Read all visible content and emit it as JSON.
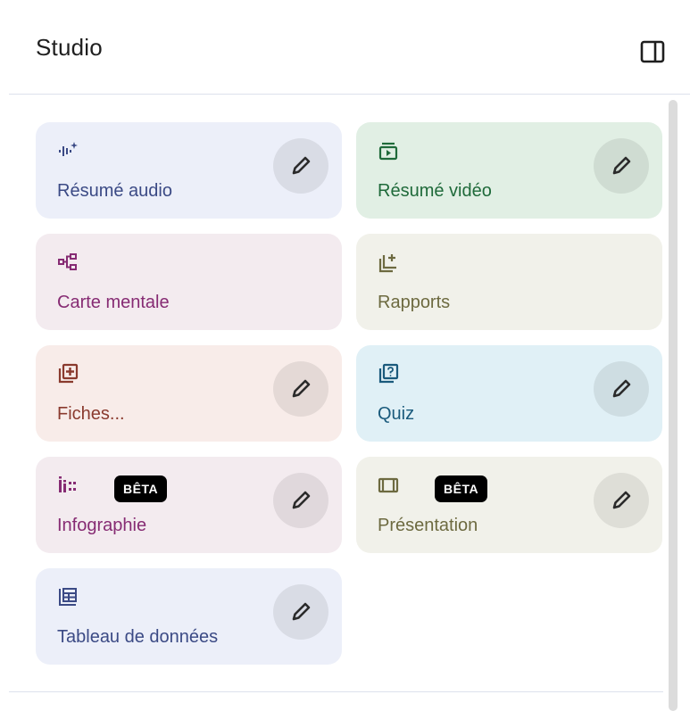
{
  "panel": {
    "title": "Studio",
    "toggle_icon": "side-panel-icon"
  },
  "cards": [
    {
      "label": "Résumé audio",
      "icon": "audio-waveform-icon",
      "text_color": "#3b4a85",
      "bg": "#eceff9",
      "editable": true
    },
    {
      "label": "Résumé vidéo",
      "icon": "video-slideshow-icon",
      "text_color": "#1f6a3a",
      "bg": "#e1efe4",
      "editable": true
    },
    {
      "label": "Carte mentale",
      "icon": "mind-map-icon",
      "text_color": "#862b73",
      "bg": "#f3ebef",
      "editable": false
    },
    {
      "label": "Rapports",
      "icon": "report-icon",
      "text_color": "#6d6a40",
      "bg": "#f1f1ea",
      "editable": false
    },
    {
      "label": "Fiches...",
      "icon": "flashcards-icon",
      "text_color": "#8a3a2e",
      "bg": "#f8ece9",
      "editable": true
    },
    {
      "label": "Quiz",
      "icon": "quiz-icon",
      "text_color": "#1a5a7c",
      "bg": "#e0f0f6",
      "editable": true
    },
    {
      "label": "Infographie",
      "icon": "infographic-icon",
      "text_color": "#862b73",
      "bg": "#f3ebef",
      "badge": "BÊTA",
      "editable": true
    },
    {
      "label": "Présentation",
      "icon": "presentation-icon",
      "text_color": "#6d6a40",
      "bg": "#f1f1ea",
      "badge": "BÊTA",
      "editable": true
    },
    {
      "label": "Tableau de données",
      "icon": "data-table-icon",
      "text_color": "#3b4a85",
      "bg": "#eceff9",
      "editable": true
    }
  ]
}
